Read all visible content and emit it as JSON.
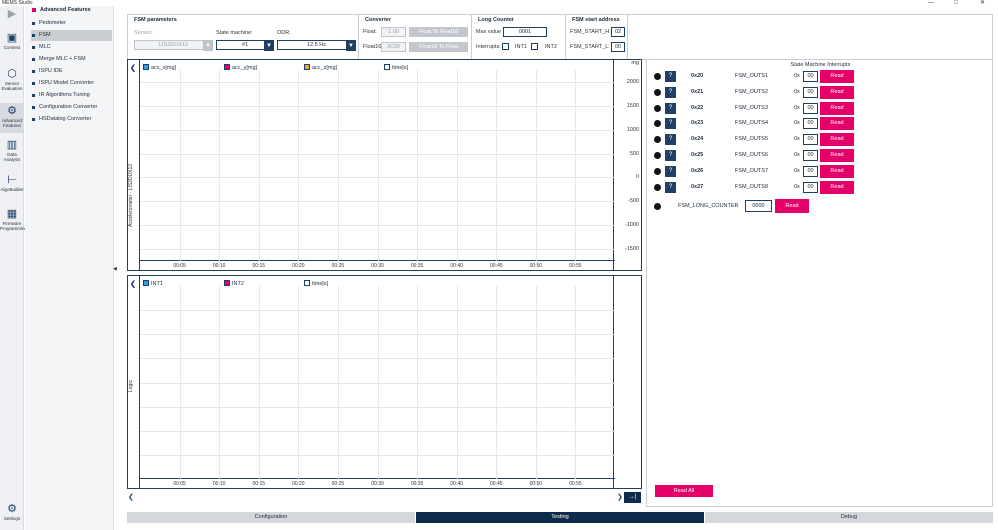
{
  "window": {
    "title": "MEMS Studio",
    "controls": [
      "—",
      "□",
      "✕"
    ]
  },
  "iconbar": [
    {
      "label": "",
      "icon": "play-icon",
      "glyph": "▶"
    },
    {
      "label": "Connect",
      "icon": "connect-icon",
      "glyph": "▣"
    },
    {
      "label": "Sensor Evaluation",
      "icon": "sensor-evaluation-icon",
      "glyph": "⬡"
    },
    {
      "label": "Advanced Features",
      "icon": "advanced-features-icon",
      "glyph": "⚙"
    },
    {
      "label": "Data Analysis",
      "icon": "data-analysis-icon",
      "glyph": "▥"
    },
    {
      "label": "AlgoBuilder",
      "icon": "algobuilder-icon",
      "glyph": "⊢"
    },
    {
      "label": "Firmware Programming",
      "icon": "firmware-programming-icon",
      "glyph": "▦"
    },
    {
      "label": "Settings",
      "icon": "settings-icon",
      "glyph": "⚙"
    }
  ],
  "nav": {
    "heading": "Advanced Features",
    "items": [
      "Pedometer",
      "FSM",
      "MLC",
      "Merge MLC + FSM",
      "ISPU IDE",
      "ISPU Model Converter",
      "IR Algorithms Tuning",
      "Configuration Converter",
      "HSDatalog Converter"
    ],
    "selected": "FSM",
    "collapse_glyph": "◀"
  },
  "params": {
    "fsm": {
      "title": "FSM parameters",
      "sensor_label": "Sensor:",
      "sensor_value": "LIS2DUX12",
      "state_label": "State machine:",
      "state_value": "#1",
      "odr_label": "ODR:",
      "odr_value": "12.5 Hz"
    },
    "converter": {
      "title": "Converter",
      "float_label": "Float:",
      "float_value": "1.00",
      "float16_label": "Float16:",
      "float16_value": "3C00",
      "to_float16": "Float To Float16",
      "to_float": "Float16 To Float"
    },
    "long_counter": {
      "title": "Long Counter",
      "max_label": "Max value",
      "max_value": "0001",
      "interrupts_label": "Interrupts:",
      "int1": "INT1",
      "int2": "INT2"
    },
    "start": {
      "title": "FSM start address",
      "h_label": "FSM_START_H:",
      "h_value": "02",
      "l_label": "FSM_START_L:",
      "l_value": "00"
    }
  },
  "accel_chart": {
    "side_label": "Accelerometer - LIS2DUX12",
    "unit": "mg",
    "legend": [
      {
        "name": "acc_x[mg]",
        "color": "#29a3e0"
      },
      {
        "name": "acc_y[mg]",
        "color": "#e5006a"
      },
      {
        "name": "acc_z[mg]",
        "color": "#f5a623"
      },
      {
        "name": "time[s]",
        "color": "#ffffff"
      }
    ],
    "yticks": [
      "2000",
      "1500",
      "1000",
      "500",
      "0",
      "-500",
      "-1000",
      "-1500"
    ],
    "xticks": [
      "00:05",
      "00:10",
      "00:15",
      "00:20",
      "00:25",
      "00:30",
      "00:35",
      "00:40",
      "00:45",
      "00:50",
      "00:55"
    ]
  },
  "logic_chart": {
    "side_label": "Logic",
    "legend": [
      {
        "name": "INT1",
        "color": "#29a3e0"
      },
      {
        "name": "INT2",
        "color": "#e5006a"
      },
      {
        "name": "time[s]",
        "color": "#ffffff"
      }
    ],
    "xticks": [
      "00:05",
      "00:10",
      "00:15",
      "00:20",
      "00:25",
      "00:30",
      "00:35",
      "00:40",
      "00:45",
      "00:50",
      "00:55"
    ]
  },
  "chart_data": [
    {
      "type": "line",
      "title": "",
      "ylabel": "Accelerometer - LIS2DUX12",
      "yunit": "mg",
      "ylim": [
        -1750,
        2250
      ],
      "xlim": [
        "00:00",
        "01:00"
      ],
      "series": [
        {
          "name": "acc_x[mg]",
          "values": []
        },
        {
          "name": "acc_y[mg]",
          "values": []
        },
        {
          "name": "acc_z[mg]",
          "values": []
        }
      ],
      "grid": true
    },
    {
      "type": "line",
      "title": "",
      "ylabel": "Logic",
      "series": [
        {
          "name": "INT1",
          "values": []
        },
        {
          "name": "INT2",
          "values": []
        }
      ],
      "grid": true
    }
  ],
  "outputs": {
    "title": "State Machine Interrupts",
    "prefix": "0x",
    "read": "Read",
    "help": "?",
    "rows": [
      {
        "addr": "0x20",
        "name": "FSM_OUTS1",
        "value": "00"
      },
      {
        "addr": "0x21",
        "name": "FSM_OUTS2",
        "value": "00"
      },
      {
        "addr": "0x22",
        "name": "FSM_OUTS3",
        "value": "00"
      },
      {
        "addr": "0x23",
        "name": "FSM_OUTS4",
        "value": "00"
      },
      {
        "addr": "0x24",
        "name": "FSM_OUTS5",
        "value": "00"
      },
      {
        "addr": "0x25",
        "name": "FSM_OUTS6",
        "value": "00"
      },
      {
        "addr": "0x26",
        "name": "FSM_OUTS7",
        "value": "00"
      },
      {
        "addr": "0x27",
        "name": "FSM_OUTS8",
        "value": "00"
      }
    ],
    "long_counter_label": "FSM_LONG_COUNTER",
    "long_counter_value": "0000",
    "read_all": "Read All"
  },
  "scroll": {
    "left": "❮",
    "right": "❯",
    "end": "→|"
  },
  "tabs": [
    "Configuration",
    "Testing",
    "Debug"
  ],
  "active_tab": "Testing"
}
